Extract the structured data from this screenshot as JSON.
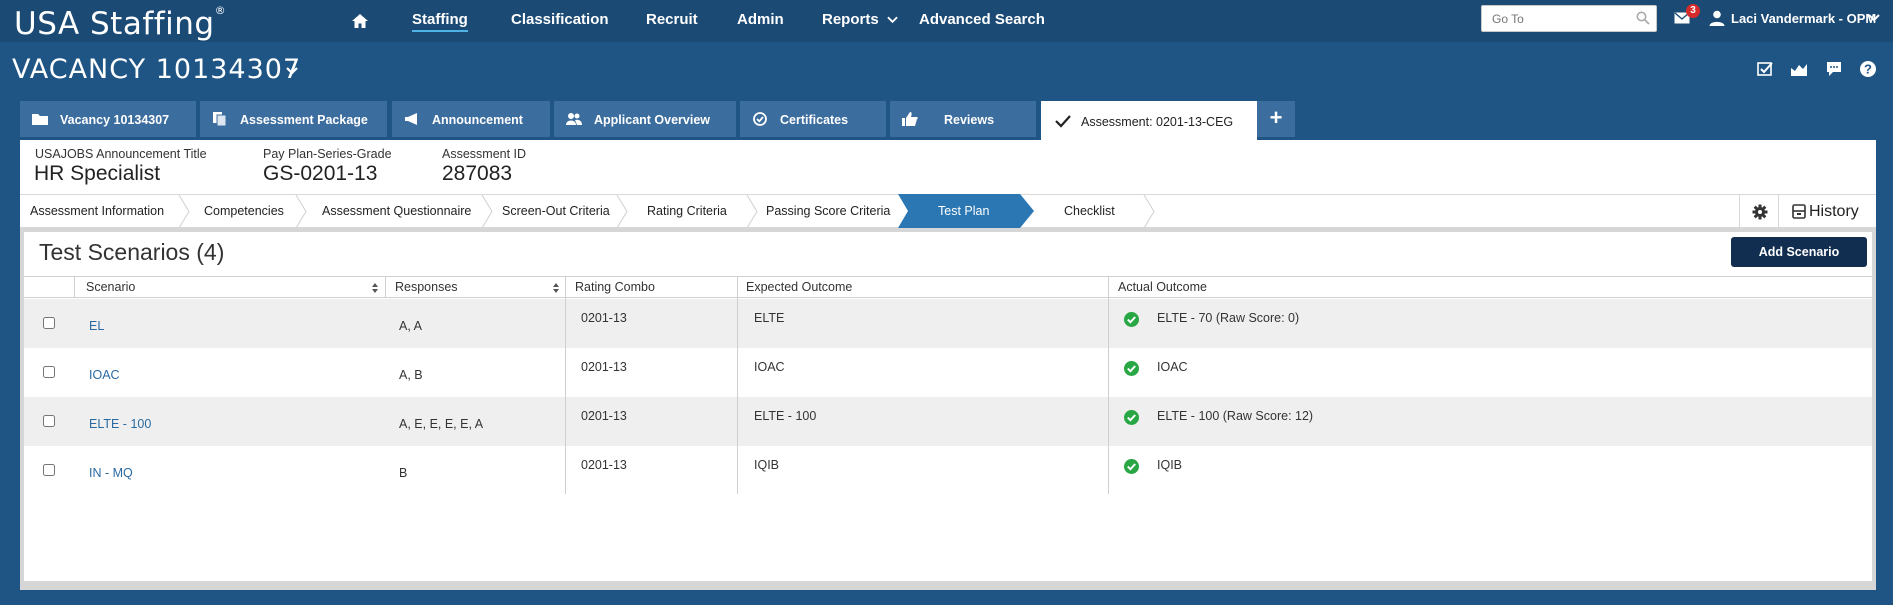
{
  "app": {
    "logo": "USA Staffing",
    "logo_mark": "®"
  },
  "nav": {
    "items": [
      "Staffing",
      "Classification",
      "Recruit",
      "Admin",
      "Reports",
      "Advanced Search"
    ],
    "goto_placeholder": "Go To",
    "mail_count": "3",
    "user_name": "Laci Vandermark - OPM"
  },
  "vacancy": {
    "title": "VACANCY 10134307"
  },
  "tabs": [
    {
      "label": "Vacancy 10134307",
      "icon": "folder-icon"
    },
    {
      "label": "Assessment Package",
      "icon": "documents-icon"
    },
    {
      "label": "Announcement",
      "icon": "megaphone-icon"
    },
    {
      "label": "Applicant Overview",
      "icon": "users-icon"
    },
    {
      "label": "Certificates",
      "icon": "certificate-icon"
    },
    {
      "label": "Reviews",
      "icon": "thumbs-up-icon"
    },
    {
      "label": "Assessment: 0201-13-CEG",
      "icon": "checkmark-icon",
      "active": true
    }
  ],
  "tab_add": "+",
  "info": {
    "announcement_label": "USAJOBS Announcement Title",
    "announcement_value": "HR Specialist",
    "pay_label": "Pay Plan-Series-Grade",
    "pay_value": "GS-0201-13",
    "assessment_label": "Assessment ID",
    "assessment_value": "287083"
  },
  "steps": [
    "Assessment Information",
    "Competencies",
    "Assessment Questionnaire",
    "Screen-Out Criteria",
    "Rating Criteria",
    "Passing Score Criteria",
    "Test Plan",
    "Checklist"
  ],
  "active_step": "Test Plan",
  "history_label": "History",
  "section": {
    "title": "Test Scenarios (4)",
    "add_button": "Add Scenario"
  },
  "table": {
    "headers": [
      "Scenario",
      "Responses",
      "Rating Combo",
      "Expected Outcome",
      "Actual Outcome"
    ],
    "rows": [
      {
        "scenario": "EL",
        "responses": "A, A",
        "rating_combo": "0201-13",
        "expected": "ELTE",
        "actual": "ELTE - 70 (Raw Score: 0)"
      },
      {
        "scenario": "IOAC",
        "responses": "A, B",
        "rating_combo": "0201-13",
        "expected": "IOAC",
        "actual": "IOAC"
      },
      {
        "scenario": "ELTE - 100",
        "responses": "A, E, E, E, E, A",
        "rating_combo": "0201-13",
        "expected": "ELTE - 100",
        "actual": "ELTE - 100 (Raw Score: 12)"
      },
      {
        "scenario": "IN - MQ",
        "responses": "B",
        "rating_combo": "0201-13",
        "expected": "IQIB",
        "actual": "IQIB"
      }
    ]
  },
  "colors": {
    "nav_bg": "#1b4a75",
    "page_bg": "#1f5585",
    "tab_bg": "#3c6d9f",
    "active_step": "#2a77b4",
    "button": "#112e51",
    "success": "#2aa745",
    "badge": "#d62b2b"
  }
}
